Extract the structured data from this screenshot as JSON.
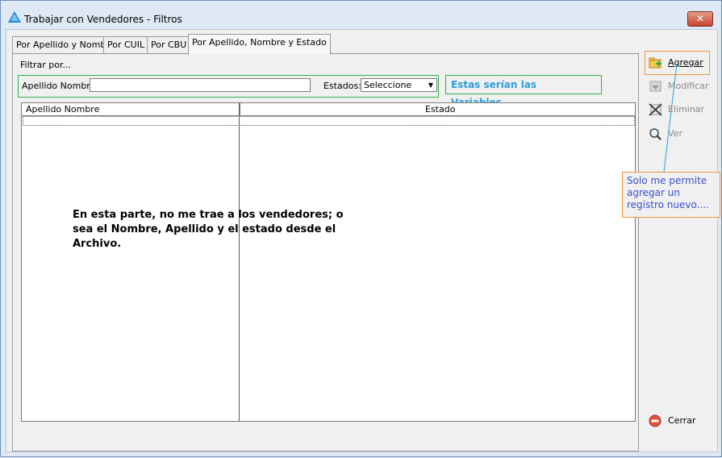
{
  "window": {
    "title": "Trabajar con Vendedores - Filtros",
    "close_symbol": "✕"
  },
  "tabs": [
    {
      "label": "Por Apellido y Nombre"
    },
    {
      "label": "Por CUIL"
    },
    {
      "label": "Por CBU"
    },
    {
      "label": "Por Apellido, Nombre y Estado"
    }
  ],
  "filter": {
    "title": "Filtrar por...",
    "apellido_label": "Apellido Nombre:",
    "apellido_value": "",
    "estados_label": "Estados:",
    "estados_value": "Seleccione"
  },
  "annotations": {
    "variables": "Estas serían las Variables...",
    "grid_note": "En esta parte, no me trae a los vendedores; o sea el Nombre, Apellido y el estado desde el Archivo.",
    "solo_note": "Solo me permite agregar un registro nuevo...."
  },
  "grid": {
    "columns": [
      "Apellido Nombre",
      "Estado"
    ],
    "rows": []
  },
  "actions": {
    "agregar": "Agregar",
    "modificar": "Modificar",
    "eliminar": "Eliminar",
    "ver": "Ver",
    "cerrar": "Cerrar"
  },
  "colors": {
    "accent_green": "#2db34a",
    "accent_orange": "#f0963a",
    "note_blue": "#2c9fd8",
    "callout_blue": "#3a4fd0"
  }
}
